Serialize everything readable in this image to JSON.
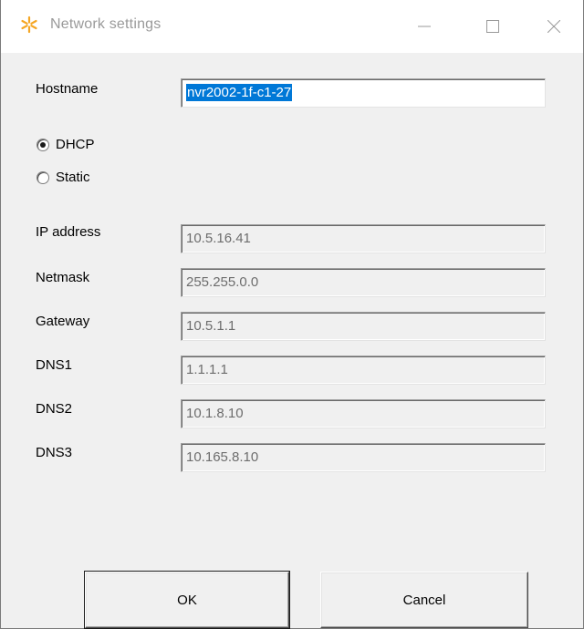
{
  "window": {
    "title": "Network settings",
    "icon": "star-icon",
    "controls": {
      "minimize": "minimize-icon",
      "maximize": "maximize-icon",
      "close": "close-icon"
    }
  },
  "hostname": {
    "label": "Hostname",
    "value": "nvr2002-1f-c1-27"
  },
  "mode": {
    "options": [
      {
        "label": "DHCP",
        "checked": true
      },
      {
        "label": "Static",
        "checked": false
      }
    ]
  },
  "fields": [
    {
      "label": "IP address",
      "value": "10.5.16.41"
    },
    {
      "label": "Netmask",
      "value": "255.255.0.0"
    },
    {
      "label": "Gateway",
      "value": "10.5.1.1"
    },
    {
      "label": "DNS1",
      "value": "1.1.1.1"
    },
    {
      "label": "DNS2",
      "value": "10.1.8.10"
    },
    {
      "label": "DNS3",
      "value": "10.165.8.10"
    }
  ],
  "buttons": {
    "ok": "OK",
    "cancel": "Cancel"
  },
  "colors": {
    "selection": "#0078d7",
    "icon_star": "#f5a623"
  }
}
